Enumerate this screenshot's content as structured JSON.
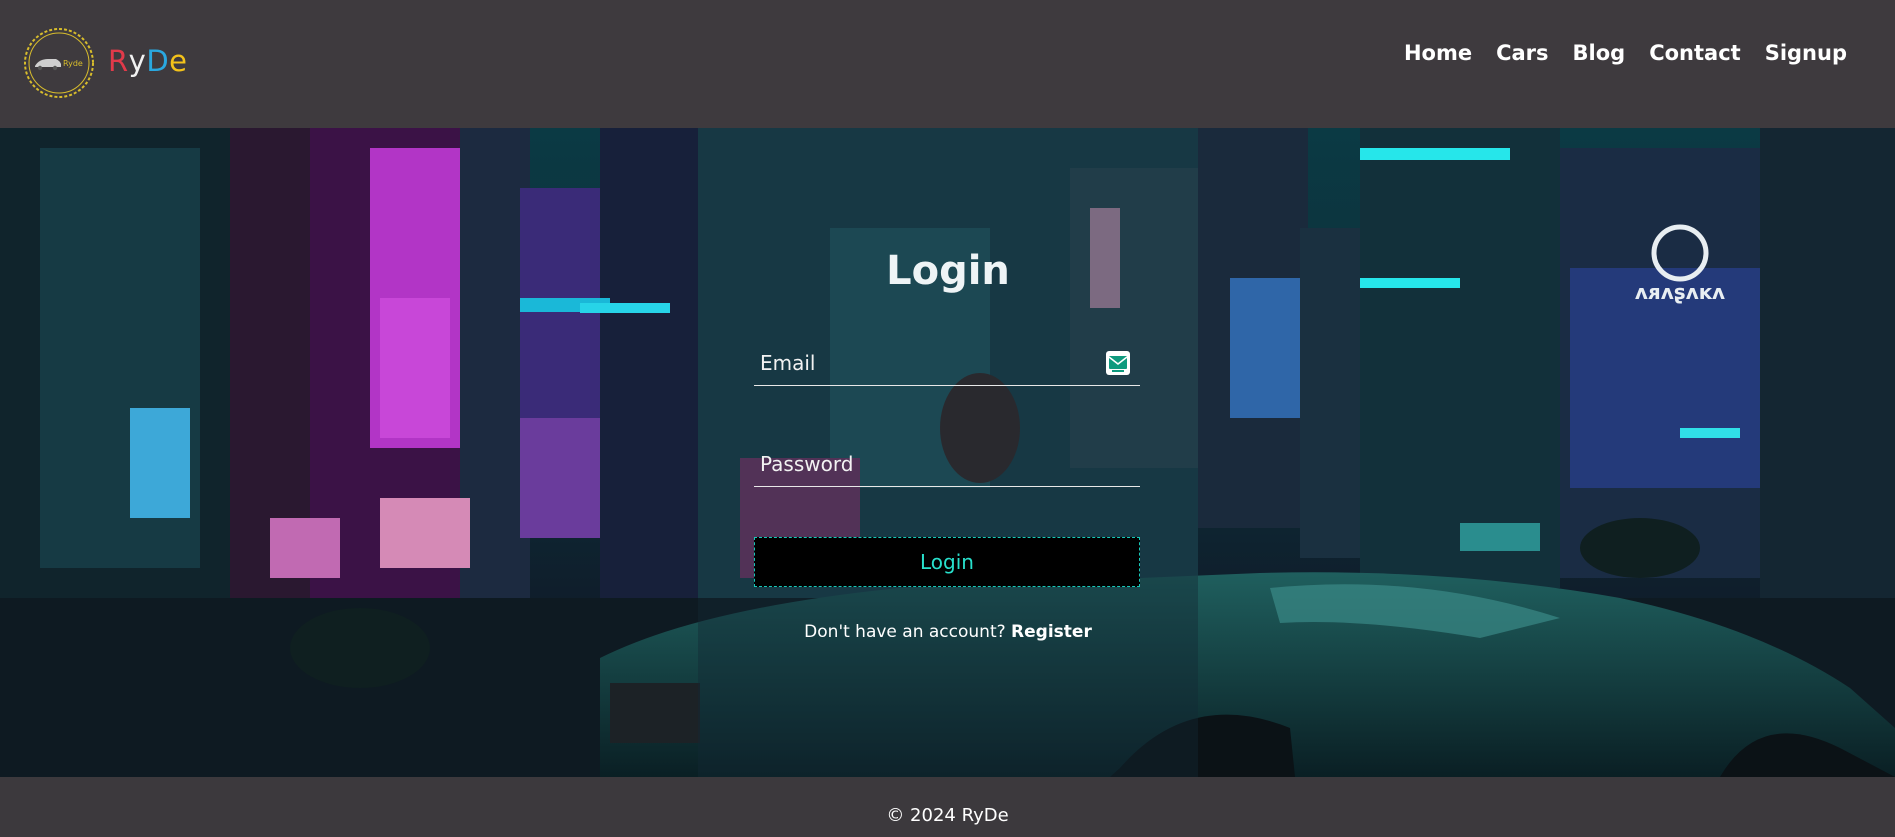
{
  "brand": {
    "letters": [
      {
        "char": "R",
        "color": "#e23a4a"
      },
      {
        "char": "y",
        "color": "#f2f2f2"
      },
      {
        "char": "D",
        "color": "#2aa8e0"
      },
      {
        "char": "e",
        "color": "#f3c21a"
      }
    ],
    "badge_text": "Ryde",
    "badge_color": "#d8bd2c"
  },
  "nav": {
    "items": [
      "Home",
      "Cars",
      "Blog",
      "Contact",
      "Signup"
    ]
  },
  "login": {
    "title": "Login",
    "email_placeholder": "Email",
    "email_icon": "envelope-icon",
    "password_placeholder": "Password",
    "button_label": "Login",
    "no_account_text": "Don't have an account?",
    "register_link": "Register",
    "accent_color": "#28e0cc"
  },
  "footer": {
    "copyright": "© 2024 RyDe"
  }
}
